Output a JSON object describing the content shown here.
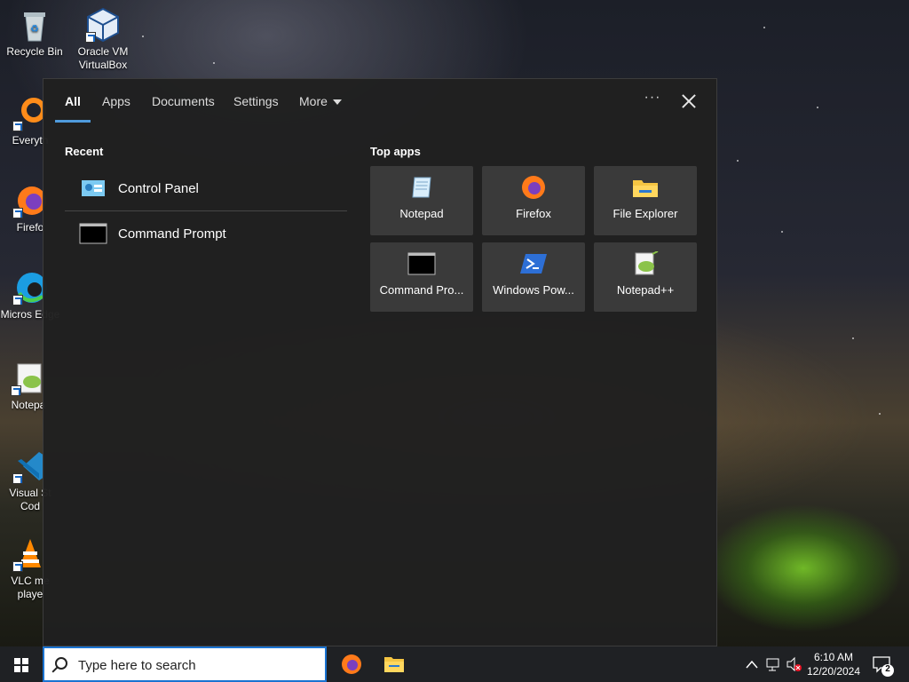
{
  "desktop": {
    "icons": [
      {
        "label": "Recycle Bin",
        "icon": "recycle-bin-icon"
      },
      {
        "label": "Oracle VM VirtualBox",
        "icon": "virtualbox-icon"
      },
      {
        "label": "Everyth",
        "icon": "everything-search-icon"
      },
      {
        "label": "Firefo",
        "icon": "firefox-icon"
      },
      {
        "label": "Micros Edge",
        "icon": "edge-icon"
      },
      {
        "label": "Notepa",
        "icon": "notepad-plus-plus-icon"
      },
      {
        "label": "Visual St Cod",
        "icon": "vscode-icon"
      },
      {
        "label": "VLC me playe",
        "icon": "vlc-icon"
      }
    ]
  },
  "search_panel": {
    "tabs": [
      {
        "label": "All",
        "active": true
      },
      {
        "label": "Apps"
      },
      {
        "label": "Documents"
      },
      {
        "label": "Settings"
      },
      {
        "label": "More"
      }
    ],
    "options_icon": "ellipsis-icon",
    "close_icon": "close-icon",
    "recent": {
      "title": "Recent",
      "items": [
        {
          "label": "Control Panel",
          "icon": "control-panel-icon"
        },
        {
          "label": "Command Prompt",
          "icon": "command-prompt-icon"
        }
      ]
    },
    "top_apps": {
      "title": "Top apps",
      "tiles": [
        {
          "label": "Notepad",
          "icon": "notepad-icon"
        },
        {
          "label": "Firefox",
          "icon": "firefox-icon"
        },
        {
          "label": "File Explorer",
          "icon": "file-explorer-icon"
        },
        {
          "label": "Command Pro...",
          "icon": "command-prompt-icon"
        },
        {
          "label": "Windows Pow...",
          "icon": "powershell-icon"
        },
        {
          "label": "Notepad++",
          "icon": "notepad-plus-plus-icon"
        }
      ]
    }
  },
  "taskbar": {
    "search_placeholder": "Type here to search",
    "pinned": [
      {
        "name": "Firefox",
        "icon": "firefox-icon"
      },
      {
        "name": "File Explorer",
        "icon": "file-explorer-icon"
      }
    ],
    "clock": {
      "time": "6:10 AM",
      "date": "12/20/2024"
    },
    "notifications_count": "2"
  },
  "colors": {
    "accent": "#4f9bdc",
    "panel_bg": "#202020",
    "tile_bg": "#3a3a3a",
    "taskbar_bg": "#1f2124"
  }
}
